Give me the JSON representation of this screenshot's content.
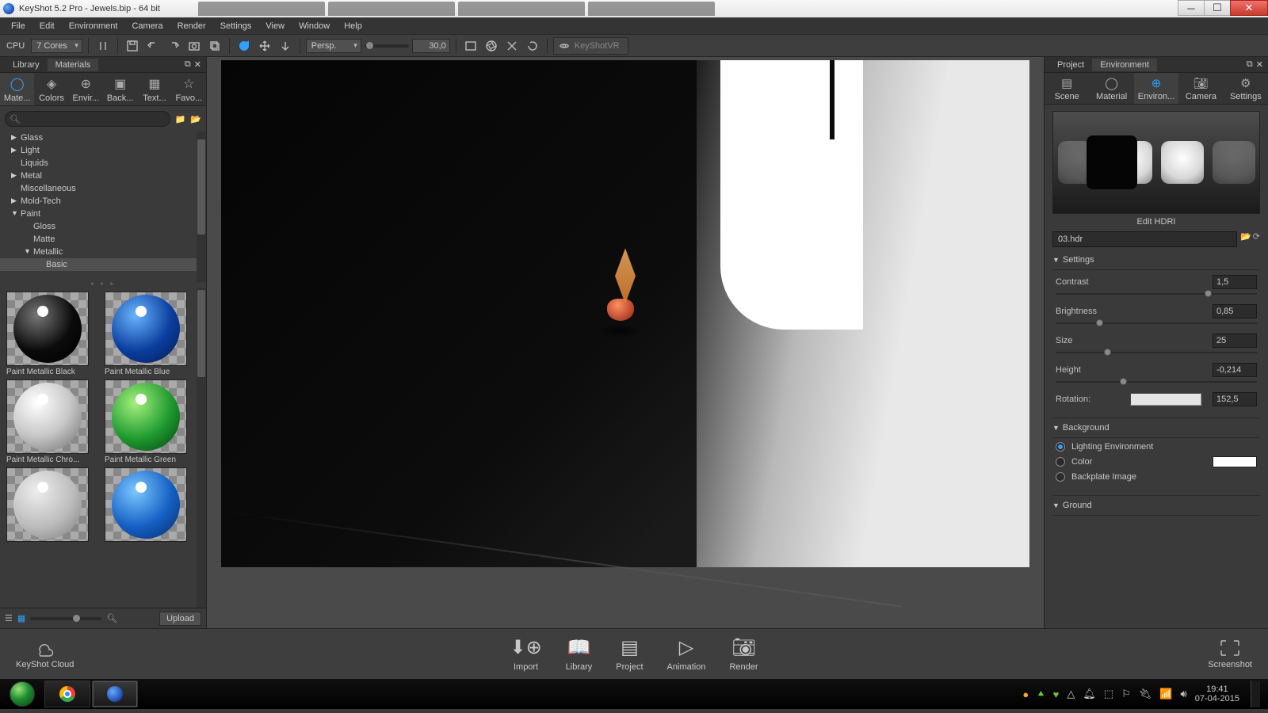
{
  "window": {
    "title": "KeyShot 5.2 Pro  - Jewels.bip  - 64 bit"
  },
  "menu": [
    "File",
    "Edit",
    "Environment",
    "Camera",
    "Render",
    "Settings",
    "View",
    "Window",
    "Help"
  ],
  "toolbar": {
    "cpu_label": "CPU",
    "cores": "7 Cores",
    "persp": "Persp.",
    "fov": "30,0",
    "ksvr": "KeyShotVR"
  },
  "library": {
    "panel_label": "Library",
    "tab_label": "Materials",
    "tabs": [
      "Mate...",
      "Colors",
      "Envir...",
      "Back...",
      "Text...",
      "Favo..."
    ],
    "search_placeholder": "",
    "tree": [
      {
        "label": "Glass",
        "level": 1,
        "arrow": "▶"
      },
      {
        "label": "Light",
        "level": 1,
        "arrow": "▶"
      },
      {
        "label": "Liquids",
        "level": 1,
        "arrow": ""
      },
      {
        "label": "Metal",
        "level": 1,
        "arrow": "▶"
      },
      {
        "label": "Miscellaneous",
        "level": 1,
        "arrow": ""
      },
      {
        "label": "Mold-Tech",
        "level": 1,
        "arrow": "▶"
      },
      {
        "label": "Paint",
        "level": 1,
        "arrow": "▼"
      },
      {
        "label": "Gloss",
        "level": 2,
        "arrow": ""
      },
      {
        "label": "Matte",
        "level": 2,
        "arrow": ""
      },
      {
        "label": "Metallic",
        "level": 2,
        "arrow": "▼"
      },
      {
        "label": "Basic",
        "level": 3,
        "arrow": "",
        "sel": true
      }
    ],
    "thumbs": [
      {
        "label": "Paint Metallic Black",
        "grad": "radial-gradient(circle at 35% 30%,#777,#0a0a0a 55%,#000)"
      },
      {
        "label": "Paint Metallic Blue",
        "grad": "radial-gradient(circle at 35% 30%,#6ab5ff,#0b3e9e 55%,#031a52)"
      },
      {
        "label": "Paint Metallic Chro...",
        "grad": "radial-gradient(circle at 35% 30%,#fff,#c8c8c8 50%,#6a6a6a)"
      },
      {
        "label": "Paint Metallic Green",
        "grad": "radial-gradient(circle at 35% 30%,#a6f07e,#1e9a2f 55%,#063c10)"
      },
      {
        "label": "",
        "grad": "radial-gradient(circle at 35% 30%,#eee,#bcbcbc 55%,#7a7a7a)"
      },
      {
        "label": "",
        "grad": "radial-gradient(circle at 35% 30%,#7cc8ff,#1560c4 55%,#052a66)"
      }
    ],
    "upload": "Upload"
  },
  "project": {
    "panel_label": "Project",
    "tab_label": "Environment",
    "tabs": [
      "Scene",
      "Material",
      "Environ...",
      "Camera",
      "Settings"
    ],
    "edit_hdri": "Edit HDRI",
    "hdr_file": "03.hdr",
    "sections": {
      "settings": "Settings",
      "background": "Background",
      "ground": "Ground"
    },
    "props": {
      "contrast_label": "Contrast",
      "contrast_value": "1,5",
      "contrast_pos": "74%",
      "brightness_label": "Brightness",
      "brightness_value": "0,85",
      "brightness_pos": "20%",
      "size_label": "Size",
      "size_value": "25",
      "size_pos": "24%",
      "height_label": "Height",
      "height_value": "-0,214",
      "height_pos": "32%",
      "rotation_label": "Rotation:",
      "rotation_value": "152,5"
    },
    "bg": {
      "lighting": "Lighting Environment",
      "color": "Color",
      "backplate": "Backplate Image"
    }
  },
  "actions": {
    "cloud": "KeyShot Cloud",
    "items": [
      "Import",
      "Library",
      "Project",
      "Animation",
      "Render"
    ],
    "screenshot": "Screenshot"
  },
  "taskbar": {
    "time": "19:41",
    "date": "07-04-2015"
  }
}
